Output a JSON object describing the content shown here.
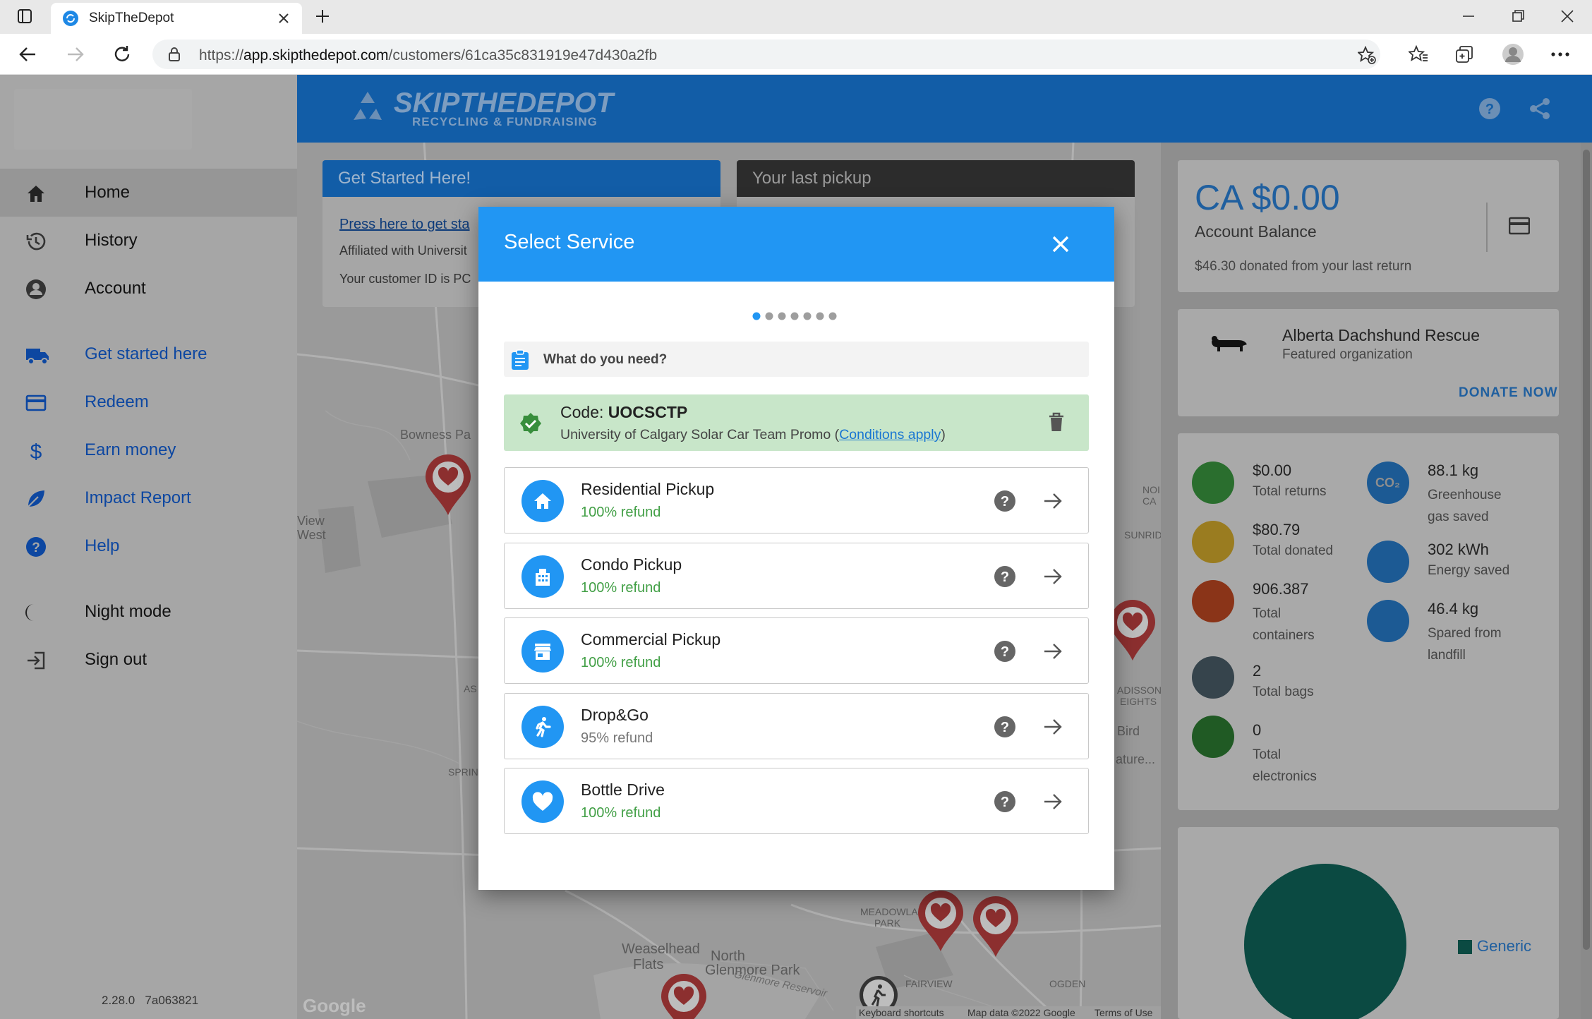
{
  "browser": {
    "tab_title": "SkipTheDepot",
    "url_prefix": "https://",
    "url_host": "app.skipthedepot.com",
    "url_path": "/customers/61ca35c831919e47d430a2fb"
  },
  "app": {
    "logo_main": "SKIPTHEDEPOT",
    "logo_sub": "RECYCLING & FUNDRAISING",
    "version": "2.28.0   7a063821"
  },
  "sidebar": {
    "items": [
      {
        "label": "Home",
        "icon": "home-icon"
      },
      {
        "label": "History",
        "icon": "history-icon"
      },
      {
        "label": "Account",
        "icon": "account-icon"
      },
      {
        "label": "Get started here",
        "icon": "truck-icon"
      },
      {
        "label": "Redeem",
        "icon": "card-icon"
      },
      {
        "label": "Earn money",
        "icon": "dollar-icon"
      },
      {
        "label": "Impact Report",
        "icon": "leaf-icon"
      },
      {
        "label": "Help",
        "icon": "help-icon"
      },
      {
        "label": "Night mode",
        "icon": "moon-icon"
      },
      {
        "label": "Sign out",
        "icon": "sign-out-icon"
      }
    ]
  },
  "cards": {
    "get_started_title": "Get Started Here!",
    "get_started_link": "Press here to get sta",
    "affiliated": "Affiliated with Universit",
    "customer_id": "Your customer ID is PC",
    "last_pickup_title": "Your last pickup"
  },
  "map": {
    "labels": [
      "Bowness Pa",
      "View",
      "West",
      "Weaselhead",
      "Flats",
      "North",
      "Glenmore Park",
      "Glenmore Reservoir",
      "MEADOWLARK",
      "PARK",
      "FAIRVIEW",
      "OGDEN",
      "Bird",
      "ature...",
      "ADISSON",
      "EIGHTS",
      "SUNRID",
      "NOI",
      "CA",
      "SPRIN",
      "AS"
    ],
    "google": "Google",
    "footer": [
      "Keyboard shortcuts",
      "Map data ©2022 Google",
      "Terms of Use"
    ]
  },
  "account": {
    "balance": "CA $0.00",
    "balance_label": "Account Balance",
    "donated_note": "$46.30 donated from your last return"
  },
  "featured": {
    "name": "Alberta Dachshund Rescue",
    "caption": "Featured organization",
    "donate": "DONATE NOW"
  },
  "stats": {
    "left": [
      {
        "value": "$0.00",
        "label": "Total returns",
        "color": "#43a047"
      },
      {
        "value": "$80.79",
        "label": "Total donated",
        "color": "#fbc02d"
      },
      {
        "value": "906.387",
        "label": "Total containers",
        "color": "#e64a19"
      },
      {
        "value": "2",
        "label": "Total bags",
        "color": "#455a64"
      },
      {
        "value": "0",
        "label": "Total electronics",
        "color": "#2e7d32"
      }
    ],
    "right": [
      {
        "value": "88.1 kg",
        "label": "Greenhouse gas saved",
        "icon_text": "CO₂"
      },
      {
        "value": "302 kWh",
        "label": "Energy saved"
      },
      {
        "value": "46.4 kg",
        "label": "Spared from landfill"
      }
    ],
    "accent": "#1e88e5"
  },
  "pie": {
    "legend": "Generic",
    "color": "#00897b"
  },
  "dialog": {
    "title": "Select Service",
    "steps_total": 7,
    "steps_current": 1,
    "question": "What do you need?",
    "code_prefix": "Code: ",
    "code": "UOCSCTP",
    "promo_text": "University of Calgary Solar Car Team Promo (",
    "conditions": "Conditions apply",
    "promo_close": ")",
    "services": [
      {
        "title": "Residential Pickup",
        "refund": "100% refund",
        "icon": "house-icon"
      },
      {
        "title": "Condo Pickup",
        "refund": "100% refund",
        "icon": "building-icon"
      },
      {
        "title": "Commercial Pickup",
        "refund": "100% refund",
        "icon": "store-icon"
      },
      {
        "title": "Drop&Go",
        "refund": "95% refund",
        "icon": "walking-person-icon"
      },
      {
        "title": "Bottle Drive",
        "refund": "100% refund",
        "icon": "heart-icon"
      }
    ],
    "colors": {
      "header": "#2196f3",
      "promo_bg": "#c8e6c9",
      "refund": "#43a047"
    }
  }
}
